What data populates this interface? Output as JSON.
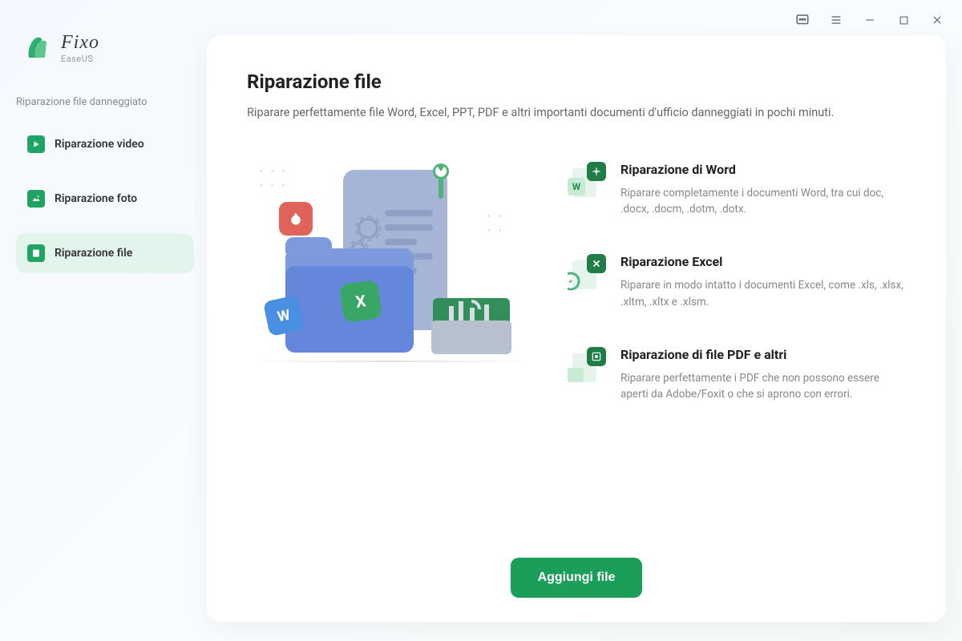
{
  "brand": {
    "name": "Fixo",
    "vendor": "EaseUS"
  },
  "sidebar": {
    "section_label": "Riparazione file danneggiato",
    "items": [
      {
        "label": "Riparazione video"
      },
      {
        "label": "Riparazione foto"
      },
      {
        "label": "Riparazione file"
      }
    ]
  },
  "main": {
    "title": "Riparazione file",
    "subtitle": "Riparare perfettamente file Word, Excel, PPT, PDF e altri importanti documenti d'ufficio danneggiati in pochi minuti.",
    "features": [
      {
        "title": "Riparazione di Word",
        "desc": "Riparare completamente i documenti Word, tra cui doc, .docx, .docm, .dotm, .dotx.",
        "color": "#1f7d45"
      },
      {
        "title": "Riparazione Excel",
        "desc": "Riparare in modo intatto i documenti Excel, come .xls, .xlsx, .xltm, .xltx e .xlsm.",
        "color": "#1f7d45"
      },
      {
        "title": "Riparazione di file PDF e altri",
        "desc": "Riparare perfettamente i PDF che non possono essere aperti da Adobe/Foxit o che si aprono con errori.",
        "color": "#1f7d45"
      }
    ],
    "add_button": "Aggiungi file"
  }
}
